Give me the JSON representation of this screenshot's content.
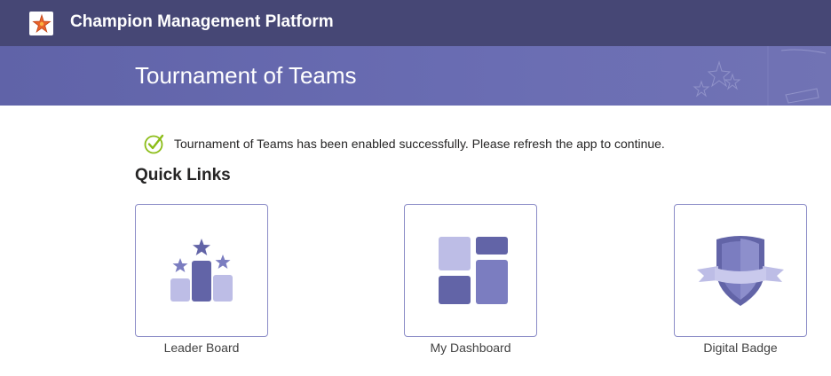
{
  "header": {
    "app_title": "Champion Management Platform",
    "logo_icon": "starfish-logo-icon"
  },
  "banner": {
    "title": "Tournament of Teams"
  },
  "notification": {
    "icon": "check-circle-icon",
    "message": "Tournament of Teams has been enabled successfully. Please refresh the app to continue."
  },
  "quick_links": {
    "title": "Quick Links",
    "items": [
      {
        "label": "Leader Board",
        "icon": "leaderboard-podium-icon"
      },
      {
        "label": "My Dashboard",
        "icon": "dashboard-grid-icon"
      },
      {
        "label": "Digital Badge",
        "icon": "shield-badge-icon"
      }
    ]
  },
  "colors": {
    "topbar": "#464775",
    "banner": "#6264a7",
    "accent_dark": "#6264a7",
    "accent_light": "#bdbde6",
    "success": "#8cbd18"
  }
}
